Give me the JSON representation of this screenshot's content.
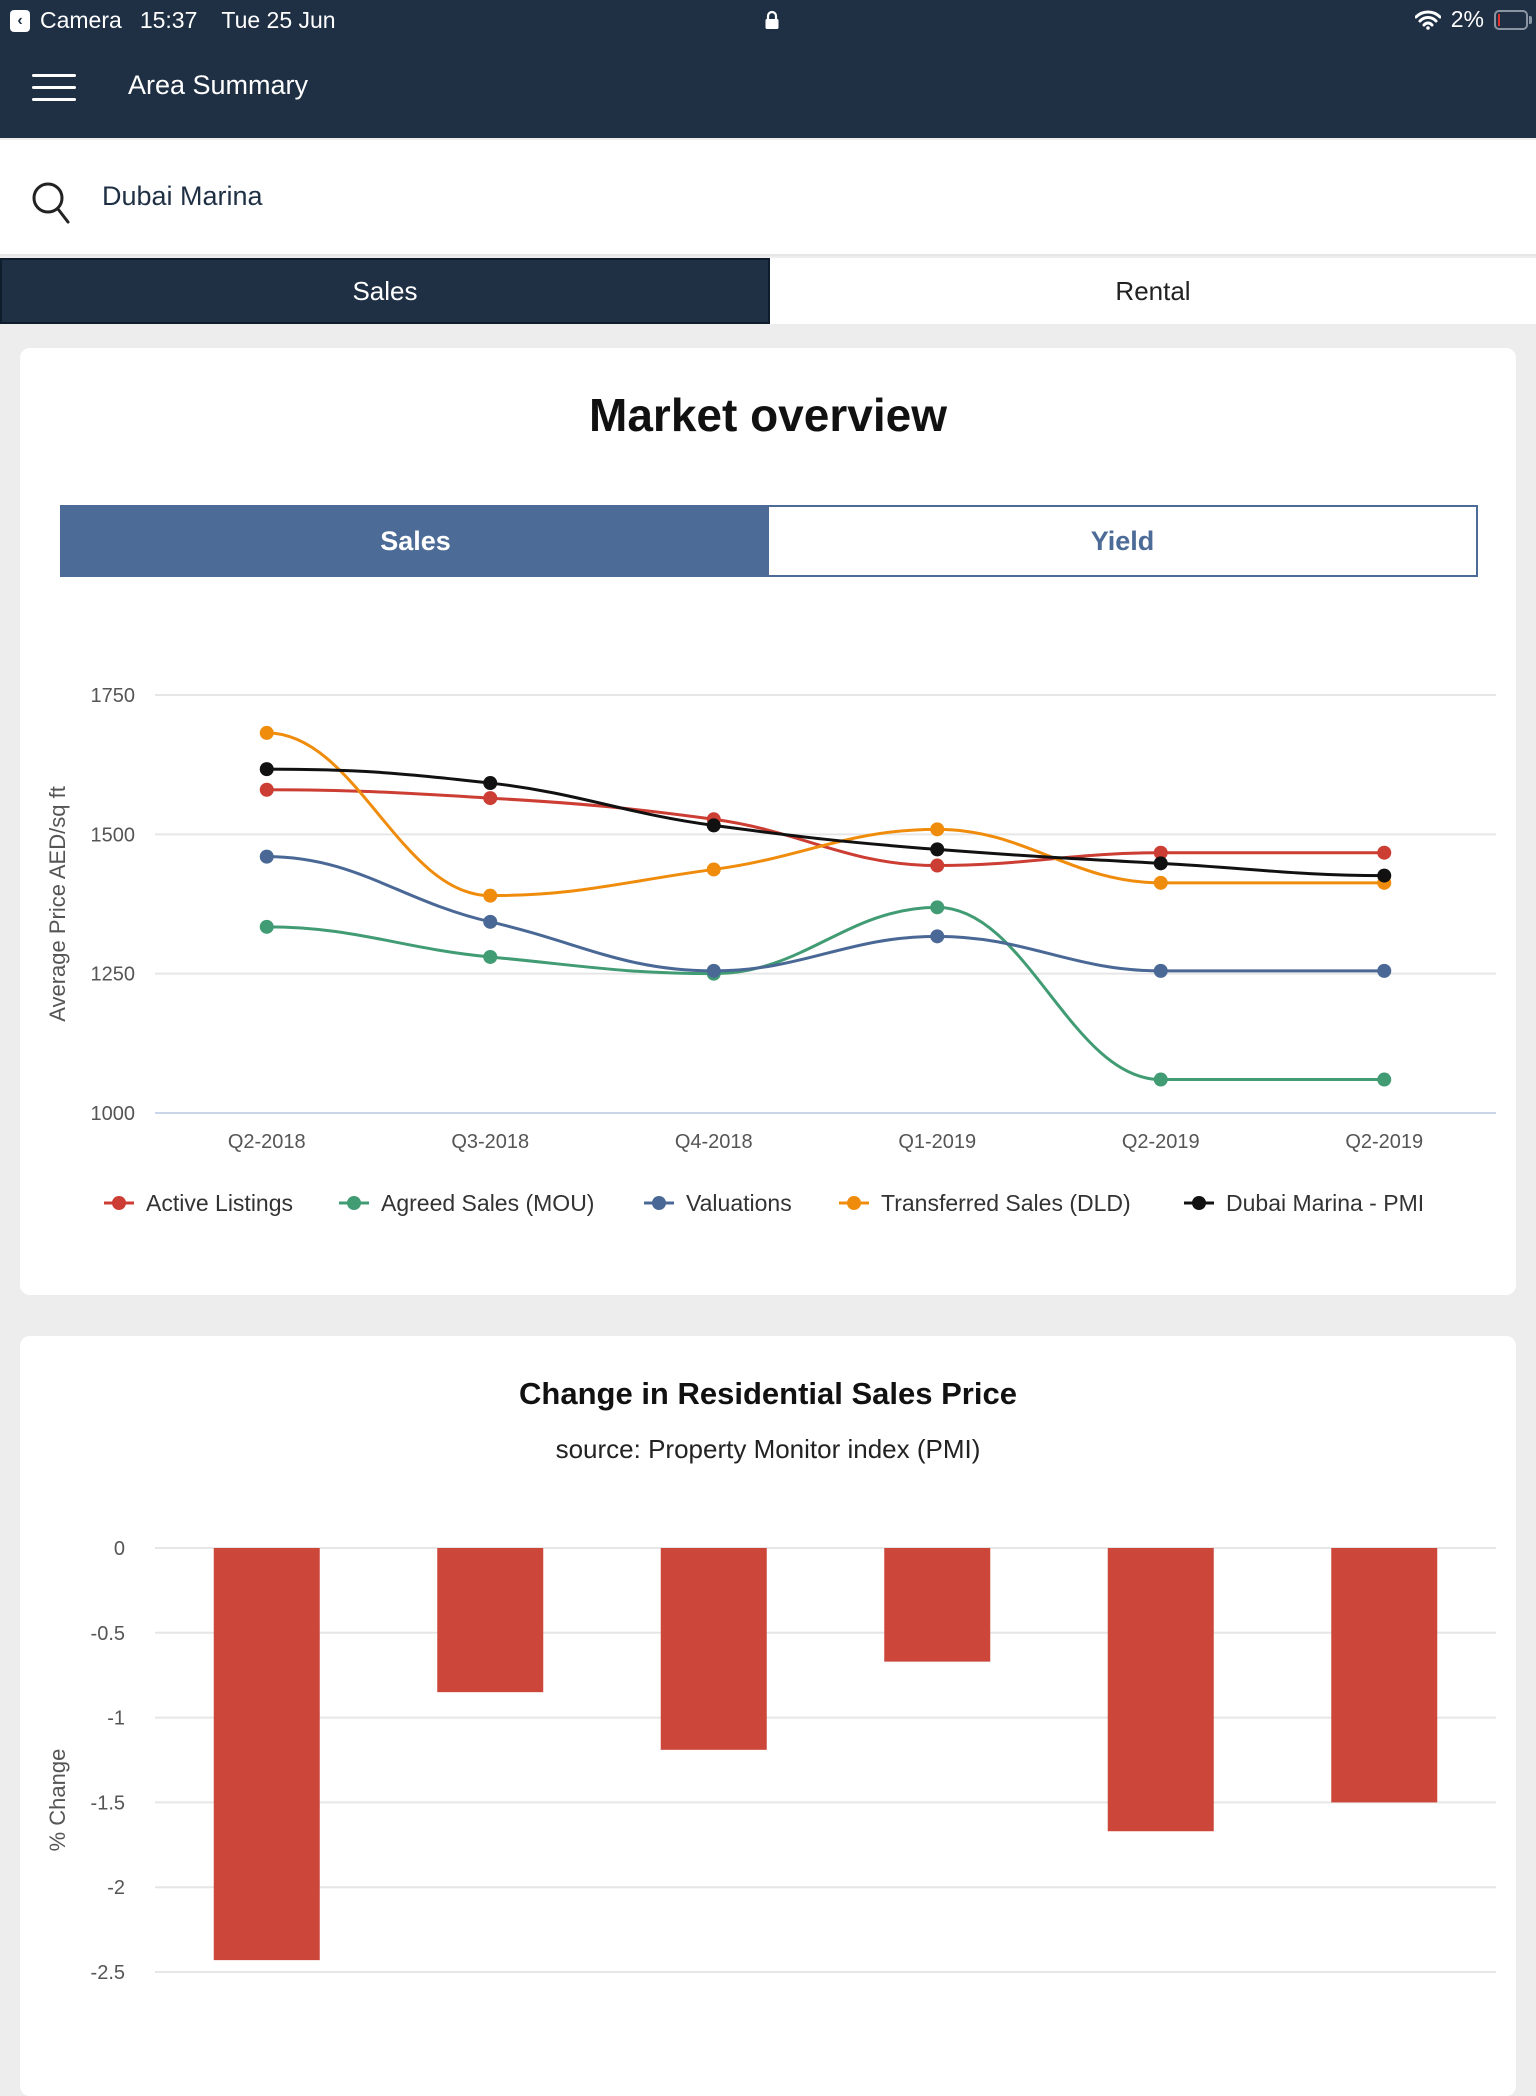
{
  "status_bar": {
    "back_app": "Camera",
    "time": "15:37",
    "date": "Tue 25 Jun",
    "battery_percent": "2%",
    "battery_level": 0.02,
    "icons": [
      "back-chevron-icon",
      "lock-icon",
      "wifi-icon",
      "battery-icon"
    ]
  },
  "app_bar": {
    "title": "Area Summary",
    "menu_icon": "hamburger-menu-icon"
  },
  "search": {
    "value": "Dubai Marina",
    "icon": "search-icon"
  },
  "main_tabs": [
    {
      "label": "Sales",
      "active": true
    },
    {
      "label": "Rental",
      "active": false
    }
  ],
  "market_overview": {
    "title": "Market overview",
    "sub_tabs": [
      {
        "label": "Sales",
        "active": true
      },
      {
        "label": "Yield",
        "active": false
      }
    ]
  },
  "change_card": {
    "title": "Change in Residential Sales Price",
    "subtitle": "source: Property Monitor index (PMI)"
  },
  "colors": {
    "navy": "#1f3045",
    "accent_blue": "#4c6b97",
    "bar_red": "#cc463a"
  },
  "chart_data": [
    {
      "type": "line",
      "title": "",
      "xlabel": "",
      "ylabel": "Average Price AED/sq ft",
      "categories": [
        "Q2-2018",
        "Q3-2018",
        "Q4-2018",
        "Q1-2019",
        "Q2-2019",
        "Q2-2019"
      ],
      "yticks": [
        "1750",
        "1500",
        "1250",
        "1000"
      ],
      "ylim": [
        1000,
        1750
      ],
      "grid": true,
      "legend_position": "bottom",
      "smooth": true,
      "series": [
        {
          "name": "Active Listings",
          "color": "#cc3d33",
          "values": [
            1580,
            1565,
            1527,
            1444,
            1467,
            1467
          ]
        },
        {
          "name": "Agreed Sales (MOU)",
          "color": "#419c74",
          "values": [
            1334,
            1280,
            1250,
            1369,
            1060,
            1060
          ]
        },
        {
          "name": "Valuations",
          "color": "#4a6896",
          "values": [
            1460,
            1343,
            1255,
            1317,
            1255,
            1255
          ]
        },
        {
          "name": "Transferred Sales (DLD)",
          "color": "#f08c0c",
          "values": [
            1682,
            1390,
            1437,
            1509,
            1413,
            1413
          ]
        },
        {
          "name": "Dubai Marina - PMI",
          "color": "#111111",
          "values": [
            1617,
            1592,
            1516,
            1473,
            1448,
            1426
          ]
        }
      ]
    },
    {
      "type": "bar",
      "title": "Change in Residential Sales Price",
      "subtitle": "source: Property Monitor index (PMI)",
      "xlabel": "",
      "ylabel": "% Change",
      "categories": [
        "",
        "",
        "",
        "",
        "",
        ""
      ],
      "values": [
        -2.43,
        -0.85,
        -1.19,
        -0.67,
        -1.67,
        -1.5
      ],
      "yticks": [
        "0",
        "-0.5",
        "-1",
        "-1.5",
        "-2",
        "-2.5"
      ],
      "ylim": [
        -2.5,
        0
      ],
      "grid": true,
      "color": "#cc463a"
    }
  ]
}
